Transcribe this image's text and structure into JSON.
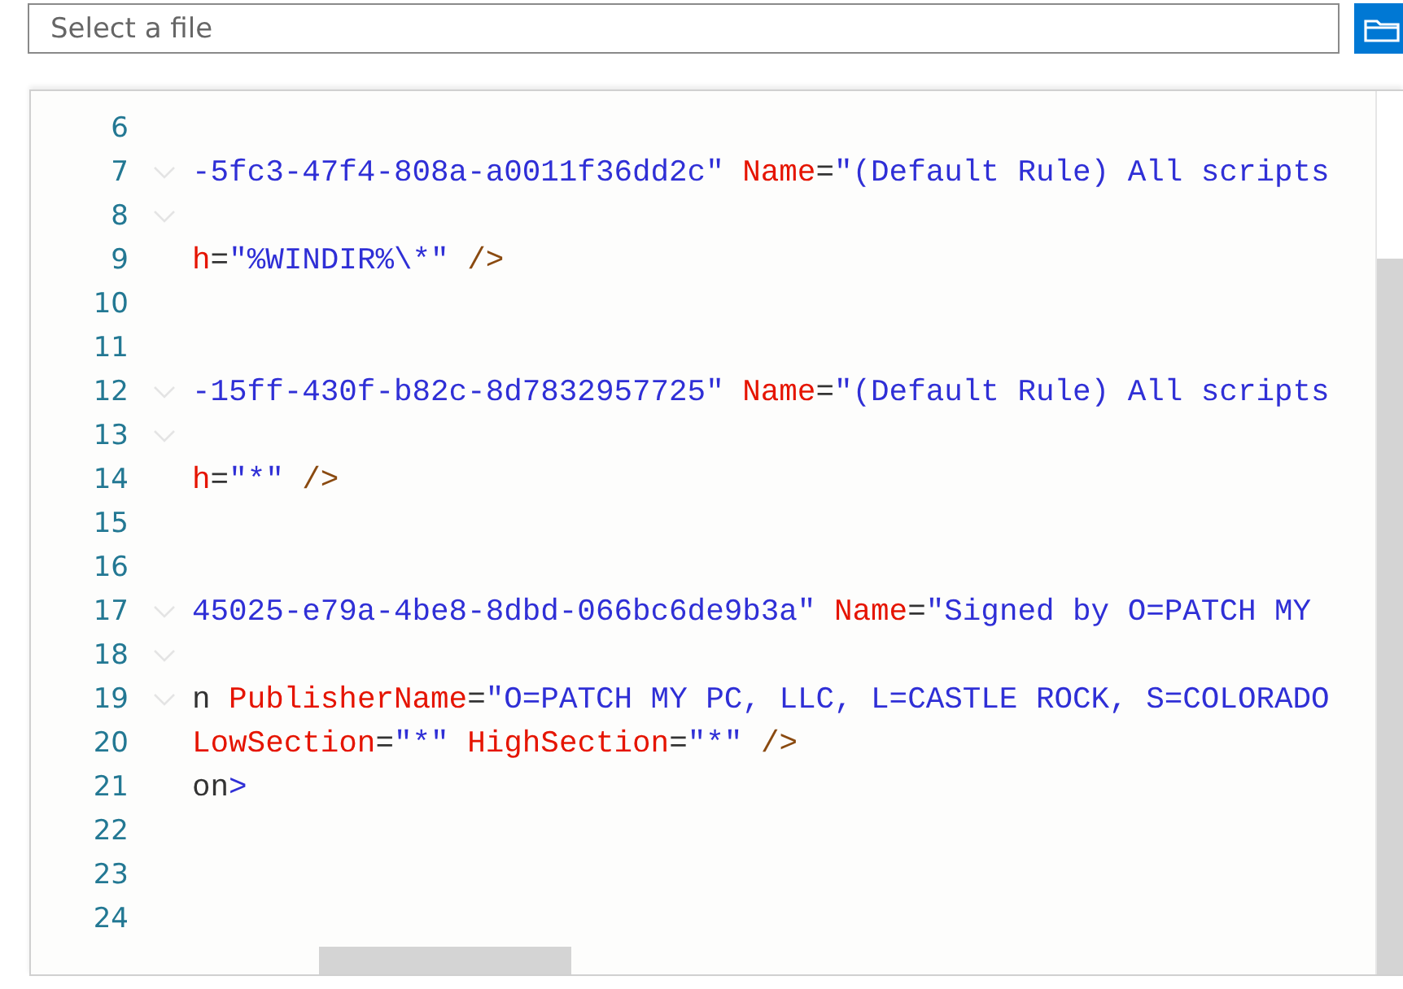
{
  "file_picker": {
    "placeholder": "Select a file"
  },
  "editor": {
    "lines": [
      {
        "number": "6",
        "foldable": false
      },
      {
        "number": "7",
        "foldable": true,
        "tokens": [
          {
            "kind": "string",
            "text": "-5fc3-47f4-808a-a0011f36dd2c\" "
          },
          {
            "kind": "attr",
            "text": "Name"
          },
          {
            "kind": "text",
            "text": "="
          },
          {
            "kind": "string",
            "text": "\"(Default Rule) All scripts"
          }
        ]
      },
      {
        "number": "8",
        "foldable": true
      },
      {
        "number": "9",
        "foldable": false,
        "tokens": [
          {
            "kind": "attr",
            "text": "h"
          },
          {
            "kind": "text",
            "text": "="
          },
          {
            "kind": "string",
            "text": "\"%WINDIR%\\*\" "
          },
          {
            "kind": "tag",
            "text": "/>"
          }
        ]
      },
      {
        "number": "10",
        "foldable": false
      },
      {
        "number": "11",
        "foldable": false
      },
      {
        "number": "12",
        "foldable": true,
        "tokens": [
          {
            "kind": "string",
            "text": "-15ff-430f-b82c-8d7832957725\" "
          },
          {
            "kind": "attr",
            "text": "Name"
          },
          {
            "kind": "text",
            "text": "="
          },
          {
            "kind": "string",
            "text": "\"(Default Rule) All scripts"
          }
        ]
      },
      {
        "number": "13",
        "foldable": true
      },
      {
        "number": "14",
        "foldable": false,
        "tokens": [
          {
            "kind": "attr",
            "text": "h"
          },
          {
            "kind": "text",
            "text": "="
          },
          {
            "kind": "string",
            "text": "\"*\" "
          },
          {
            "kind": "tag",
            "text": "/>"
          }
        ]
      },
      {
        "number": "15",
        "foldable": false
      },
      {
        "number": "16",
        "foldable": false
      },
      {
        "number": "17",
        "foldable": true,
        "tokens": [
          {
            "kind": "string",
            "text": "45025-e79a-4be8-8dbd-066bc6de9b3a\" "
          },
          {
            "kind": "attr",
            "text": "Name"
          },
          {
            "kind": "text",
            "text": "="
          },
          {
            "kind": "string",
            "text": "\"Signed by O=PATCH MY"
          }
        ]
      },
      {
        "number": "18",
        "foldable": true
      },
      {
        "number": "19",
        "foldable": true,
        "tokens": [
          {
            "kind": "text",
            "text": "n "
          },
          {
            "kind": "attr",
            "text": "PublisherName"
          },
          {
            "kind": "text",
            "text": "="
          },
          {
            "kind": "string",
            "text": "\"O=PATCH MY PC, LLC, L=CASTLE ROCK, S=COLORADO"
          }
        ]
      },
      {
        "number": "20",
        "foldable": false,
        "tokens": [
          {
            "kind": "attr",
            "text": "LowSection"
          },
          {
            "kind": "text",
            "text": "="
          },
          {
            "kind": "string",
            "text": "\"*\" "
          },
          {
            "kind": "attr",
            "text": "HighSection"
          },
          {
            "kind": "text",
            "text": "="
          },
          {
            "kind": "string",
            "text": "\"*\" "
          },
          {
            "kind": "tag",
            "text": "/>"
          }
        ]
      },
      {
        "number": "21",
        "foldable": false,
        "tokens": [
          {
            "kind": "text",
            "text": "on"
          },
          {
            "kind": "bracket",
            "text": ">"
          }
        ]
      },
      {
        "number": "22",
        "foldable": false
      },
      {
        "number": "23",
        "foldable": false
      },
      {
        "number": "24",
        "foldable": false
      }
    ]
  }
}
